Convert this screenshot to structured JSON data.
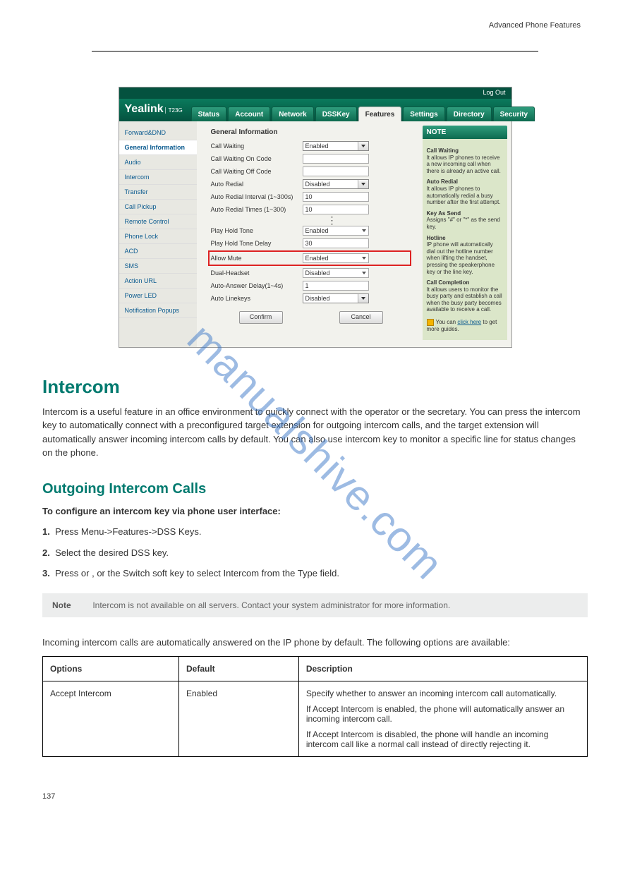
{
  "page_header": {
    "right": "Advanced Phone Features"
  },
  "screenshot": {
    "logout": "Log Out",
    "brand": "Yealink",
    "brand_sub": "T23G",
    "tabs": [
      "Status",
      "Account",
      "Network",
      "DSSKey",
      "Features",
      "Settings",
      "Directory",
      "Security"
    ],
    "active_tab_index": 4,
    "sidebar": [
      "Forward&DND",
      "General Information",
      "Audio",
      "Intercom",
      "Transfer",
      "Call Pickup",
      "Remote Control",
      "Phone Lock",
      "ACD",
      "SMS",
      "Action URL",
      "Power LED",
      "Notification Popups"
    ],
    "active_side_index": 1,
    "form_title": "General Information",
    "rows_top": [
      {
        "label": "Call Waiting",
        "value": "Enabled",
        "type": "selectbox"
      },
      {
        "label": "Call Waiting On Code",
        "value": "",
        "type": "text"
      },
      {
        "label": "Call Waiting Off Code",
        "value": "",
        "type": "text"
      },
      {
        "label": "Auto Redial",
        "value": "Disabled",
        "type": "selectbox"
      },
      {
        "label": "Auto Redial Interval (1~300s)",
        "value": "10",
        "type": "text"
      },
      {
        "label": "Auto Redial Times (1~300)",
        "value": "10",
        "type": "text"
      }
    ],
    "rows_bottom": [
      {
        "label": "Play Hold Tone",
        "value": "Enabled",
        "type": "select"
      },
      {
        "label": "Play Hold Tone Delay",
        "value": "30",
        "type": "text"
      },
      {
        "label": "Allow Mute",
        "value": "Enabled",
        "type": "select",
        "highlight": true
      },
      {
        "label": "Dual-Headset",
        "value": "Disabled",
        "type": "select"
      },
      {
        "label": "Auto-Answer Delay(1~4s)",
        "value": "1",
        "type": "text"
      },
      {
        "label": "Auto Linekeys",
        "value": "Disabled",
        "type": "selectbox"
      }
    ],
    "confirm": "Confirm",
    "cancel": "Cancel",
    "note": {
      "title": "NOTE",
      "items": [
        {
          "head": "Call Waiting",
          "body": "It allows IP phones to receive a new incoming call when there is already an active call."
        },
        {
          "head": "Auto Redial",
          "body": "It allows IP phones to automatically redial a busy number after the first attempt."
        },
        {
          "head": "Key As Send",
          "body": "Assigns \"#\" or \"*\" as the send key."
        },
        {
          "head": "Hotline",
          "body": "IP phone will automatically dial out the hotline number when lifting the handset, pressing the speakerphone key or the line key."
        },
        {
          "head": "Call Completion",
          "body": "It allows users to monitor the busy party and establish a call when the busy party becomes available to receive a call."
        }
      ],
      "link_prefix": "You can ",
      "link_text": "click here",
      "link_suffix": " to get more guides."
    }
  },
  "watermark": "manualshive.com",
  "section1": {
    "title": "Intercom",
    "para1": "Intercom is a useful feature in an office environment to quickly connect with the operator or the secretary. You can press the intercom key to automatically connect with a preconfigured target extension for outgoing intercom calls, and the target extension will automatically answer incoming intercom calls by default. You can also use intercom key to monitor a specific line for status changes on the phone."
  },
  "section2": {
    "title": "Outgoing Intercom Calls",
    "lead": "To configure an intercom key via phone user interface:",
    "steps": [
      "Press Menu->Features->DSS Keys.",
      "Select the desired DSS key.",
      "Press            or           , or the Switch soft key to select Intercom from the Type field."
    ],
    "step_numbers": [
      "1.",
      "2.",
      "3."
    ],
    "arrow_left_icon": "arrow-left-key-icon",
    "arrow_right_icon": "arrow-right-key-icon"
  },
  "note_block": "Intercom is not available on all servers. Contact your system administrator for more information.",
  "note_block_label": "Note",
  "table": {
    "headers": [
      "Options",
      "Default",
      "Description"
    ],
    "row1_col1": "Accept Intercom",
    "row1_col2": "Enabled",
    "row1_col3_p1": "Specify whether to answer an incoming intercom call automatically.",
    "row1_col3_p2": "If Accept Intercom is enabled, the phone will automatically answer an incoming intercom call.",
    "row1_col3_p3": "If Accept Intercom is disabled, the phone will handle an incoming intercom call like a normal call instead of directly rejecting it."
  },
  "bottom_page": "137"
}
